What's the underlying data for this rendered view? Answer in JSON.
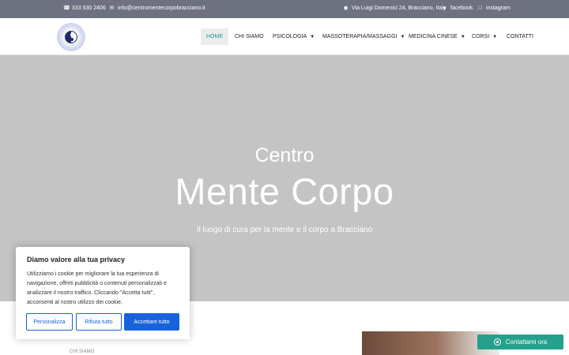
{
  "topbar": {
    "phone": "333 530 2406",
    "email": "info@centromentecorpobracciano.it",
    "address": "Via Luigi Domenici 24, Bracciano, Italy",
    "facebook": "facebook",
    "instagram": "instagram",
    "icons": {
      "phone": "phone-icon",
      "email": "envelope-icon",
      "address": "location-pin-icon",
      "facebook": "facebook-icon",
      "instagram": "instagram-icon"
    }
  },
  "nav": {
    "items": [
      {
        "label": "HOME",
        "active": true
      },
      {
        "label": "CHI SIAMO"
      },
      {
        "label": "PSICOLOGIA",
        "dropdown": true
      },
      {
        "label": "MASSOTERAPIA/MASSAGGI",
        "dropdown": true
      },
      {
        "label": "MEDICINA CINESE",
        "dropdown": true
      },
      {
        "label": "CORSI",
        "dropdown": true
      },
      {
        "label": "CONTATTI"
      }
    ]
  },
  "hero": {
    "pre_title": "Centro",
    "title": "Mente Corpo",
    "tagline": "Il luogo di cura per la mente e il corpo a Bracciano"
  },
  "section": {
    "label": "CHI SIAMO"
  },
  "cookie": {
    "title": "Diamo valore alla tua privacy",
    "text": "Utilizziamo i cookie per migliorare la tua esperienza di navigazione, offrirti pubblicità o contenuti personalizzati e analizzare il nostro traffico. Cliccando \"Accetta tutti\", acconsenti al nostro utilizzo dei cookie.",
    "customize": "Personalizza",
    "reject": "Rifiuta tutto",
    "accept": "Accettare tutto"
  },
  "whatsapp": {
    "label": "Contattami ora"
  },
  "colors": {
    "topbar": "#6e7180",
    "accent": "#1b9c9c",
    "hero": "#c4c4c5",
    "cookie_button": "#1863dc",
    "whatsapp": "#24a18c"
  }
}
